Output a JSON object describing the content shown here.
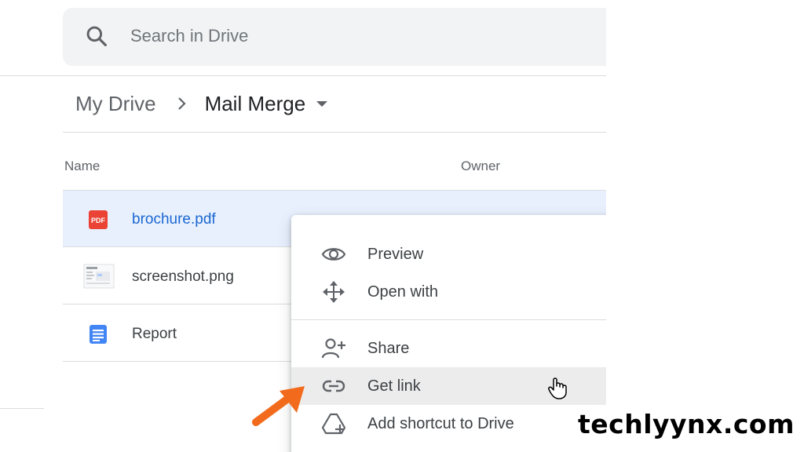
{
  "search": {
    "placeholder": "Search in Drive"
  },
  "breadcrumb": {
    "root": "My Drive",
    "current": "Mail Merge"
  },
  "columns": {
    "name": "Name",
    "owner": "Owner"
  },
  "files": [
    {
      "name": "brochure.pdf",
      "icon": "pdf-file-icon",
      "selected": true
    },
    {
      "name": "screenshot.png",
      "icon": "image-thumbnail-icon",
      "selected": false
    },
    {
      "name": "Report",
      "icon": "google-docs-icon",
      "selected": false
    }
  ],
  "context_menu": {
    "items": [
      {
        "label": "Preview",
        "icon": "eye-icon"
      },
      {
        "label": "Open with",
        "icon": "move-arrows-icon"
      },
      {
        "label": "Share",
        "icon": "person-add-icon"
      },
      {
        "label": "Get link",
        "icon": "link-icon",
        "hovered": true
      },
      {
        "label": "Add shortcut to Drive",
        "icon": "drive-shortcut-icon"
      }
    ]
  },
  "watermark": "techlyynx.com",
  "colors": {
    "accent_blue": "#1967d2",
    "selected_row": "#e8f0fe",
    "pdf_red": "#ea4335",
    "docs_blue": "#4285f4",
    "arrow_orange": "#f26b1d"
  }
}
